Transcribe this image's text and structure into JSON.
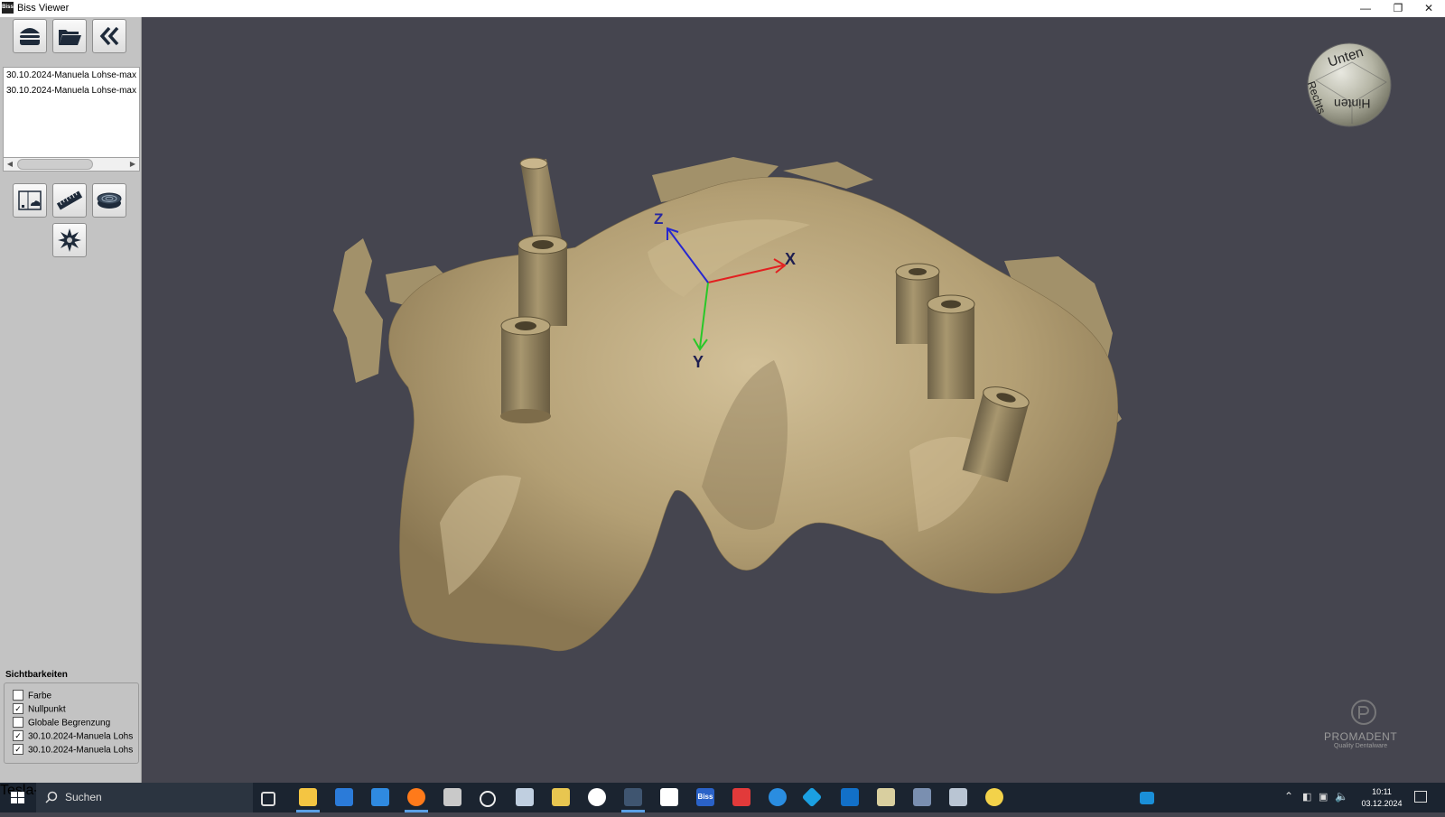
{
  "window": {
    "title": "Biss Viewer",
    "app_icon": "Biss"
  },
  "toolbar_top": [
    {
      "name": "burger-icon"
    },
    {
      "name": "folder-open-icon"
    },
    {
      "name": "double-chevron-left-icon"
    }
  ],
  "file_list": {
    "items": [
      "30.10.2024-Manuela Lohse-max",
      "30.10.2024-Manuela Lohse-max"
    ]
  },
  "tools": [
    {
      "name": "image-export-icon"
    },
    {
      "name": "ruler-icon"
    },
    {
      "name": "section-disc-icon"
    },
    {
      "name": "star-burst-icon"
    }
  ],
  "visibility": {
    "title": "Sichtbarkeiten",
    "items": [
      {
        "label": "Farbe",
        "checked": false,
        "mark": ""
      },
      {
        "label": "Nullpunkt",
        "checked": true,
        "mark": "✓"
      },
      {
        "label": "Globale Begrenzung",
        "checked": false,
        "mark": ""
      },
      {
        "label": "30.10.2024-Manuela Lohs",
        "checked": true,
        "mark": "✓"
      },
      {
        "label": "30.10.2024-Manuela Lohs",
        "checked": true,
        "mark": "✓"
      }
    ]
  },
  "viewport": {
    "axes": {
      "x": "X",
      "y": "Y",
      "z": "Z"
    },
    "colors": {
      "background": "#45454f",
      "model": "#b9a57c",
      "x_axis": "#e22020",
      "y_axis": "#28c828",
      "z_axis": "#2727d0"
    },
    "view_cube": {
      "top": "Unten",
      "side": "Hinten",
      "left": "Rechts"
    },
    "watermark": {
      "brand": "PROMADENT",
      "tagline": "Quality Dentalware"
    }
  },
  "taskbar": {
    "search_placeholder": "Suchen",
    "news": "Tesla-Chef Elon Musk...",
    "time": "10:11",
    "date": "03.12.2024",
    "biss_label": "Biss"
  }
}
